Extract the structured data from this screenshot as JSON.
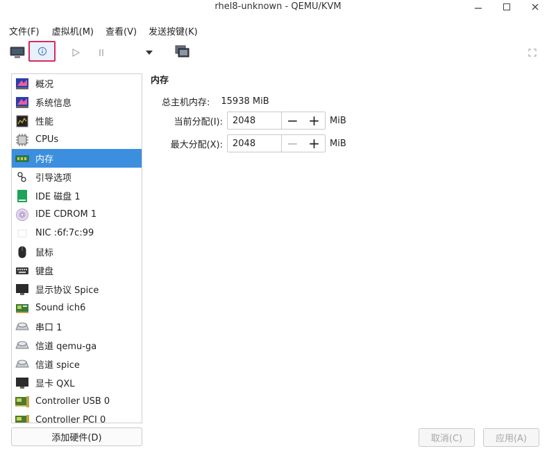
{
  "window": {
    "title": "rhel8-unknown - QEMU/KVM"
  },
  "menubar": [
    "文件(F)",
    "虚拟机(M)",
    "查看(V)",
    "发送按键(K)"
  ],
  "sidebar": {
    "items": [
      {
        "label": "概况",
        "icon": "overview-icon"
      },
      {
        "label": "系统信息",
        "icon": "system-info-icon"
      },
      {
        "label": "性能",
        "icon": "performance-icon"
      },
      {
        "label": "CPUs",
        "icon": "cpu-icon"
      },
      {
        "label": "内存",
        "icon": "memory-icon",
        "selected": true
      },
      {
        "label": "引导选项",
        "icon": "boot-options-icon"
      },
      {
        "label": "IDE 磁盘 1",
        "icon": "disk-icon"
      },
      {
        "label": "IDE CDROM 1",
        "icon": "cdrom-icon"
      },
      {
        "label": "NIC :6f:7c:99",
        "icon": "nic-icon"
      },
      {
        "label": "鼠标",
        "icon": "mouse-icon"
      },
      {
        "label": "键盘",
        "icon": "keyboard-icon"
      },
      {
        "label": "显示协议 Spice",
        "icon": "display-icon"
      },
      {
        "label": "Sound ich6",
        "icon": "sound-icon"
      },
      {
        "label": "串口 1",
        "icon": "serial-icon"
      },
      {
        "label": "信道 qemu-ga",
        "icon": "channel-icon"
      },
      {
        "label": "信道 spice",
        "icon": "channel-icon"
      },
      {
        "label": "显卡 QXL",
        "icon": "video-card-icon"
      },
      {
        "label": "Controller USB 0",
        "icon": "controller-icon"
      },
      {
        "label": "Controller PCI 0",
        "icon": "controller-icon"
      }
    ],
    "add_hardware_label": "添加硬件(D)"
  },
  "memory": {
    "heading": "内存",
    "total_label": "总主机内存:",
    "total_value": "15938 MiB",
    "current_label": "当前分配(I):",
    "current_value": "2048",
    "max_label": "最大分配(X):",
    "max_value": "2048",
    "unit": "MiB",
    "minus": "−",
    "plus": "+"
  },
  "footer": {
    "cancel_label": "取消(C)",
    "apply_label": "应用(A)"
  },
  "colors": {
    "selection": "#3c8fde",
    "details_highlight": "#d62b5a"
  }
}
